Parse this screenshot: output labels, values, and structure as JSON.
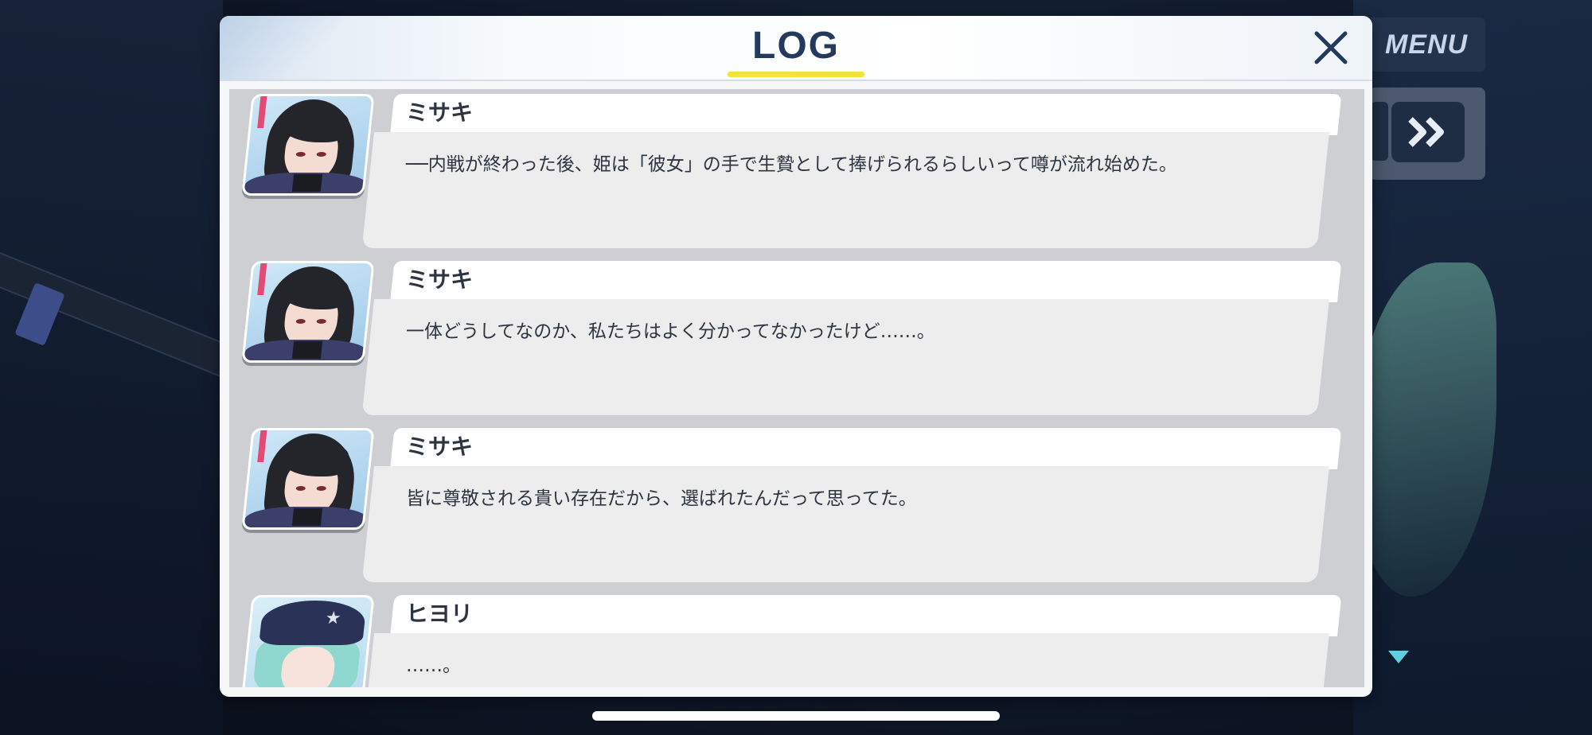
{
  "log": {
    "title": "LOG",
    "entries": [
      {
        "speaker": "ミサキ",
        "portrait": "misaki-portrait",
        "message": "──内戦が終わった後、姫は「彼女」の手で生贄として捧げられるらしいって噂が流れ始めた。"
      },
      {
        "speaker": "ミサキ",
        "portrait": "misaki-portrait",
        "message": "一体どうしてなのか、私たちはよく分かってなかったけど……。"
      },
      {
        "speaker": "ミサキ",
        "portrait": "misaki-portrait",
        "message": "皆に尊敬される貴い存在だから、選ばれたんだって思ってた。"
      },
      {
        "speaker": "ヒヨリ",
        "portrait": "hiyori-portrait",
        "message": "……。"
      }
    ]
  },
  "controls": {
    "menu_label": "MENU"
  },
  "colors": {
    "title": "#24395c",
    "title_underline": "#f2e23a",
    "text": "#2d3442",
    "next_indicator": "#5fd0e0"
  },
  "icons": {
    "close": "close-icon",
    "fast_forward": "fast-forward-icon",
    "next": "next-arrow-icon"
  }
}
